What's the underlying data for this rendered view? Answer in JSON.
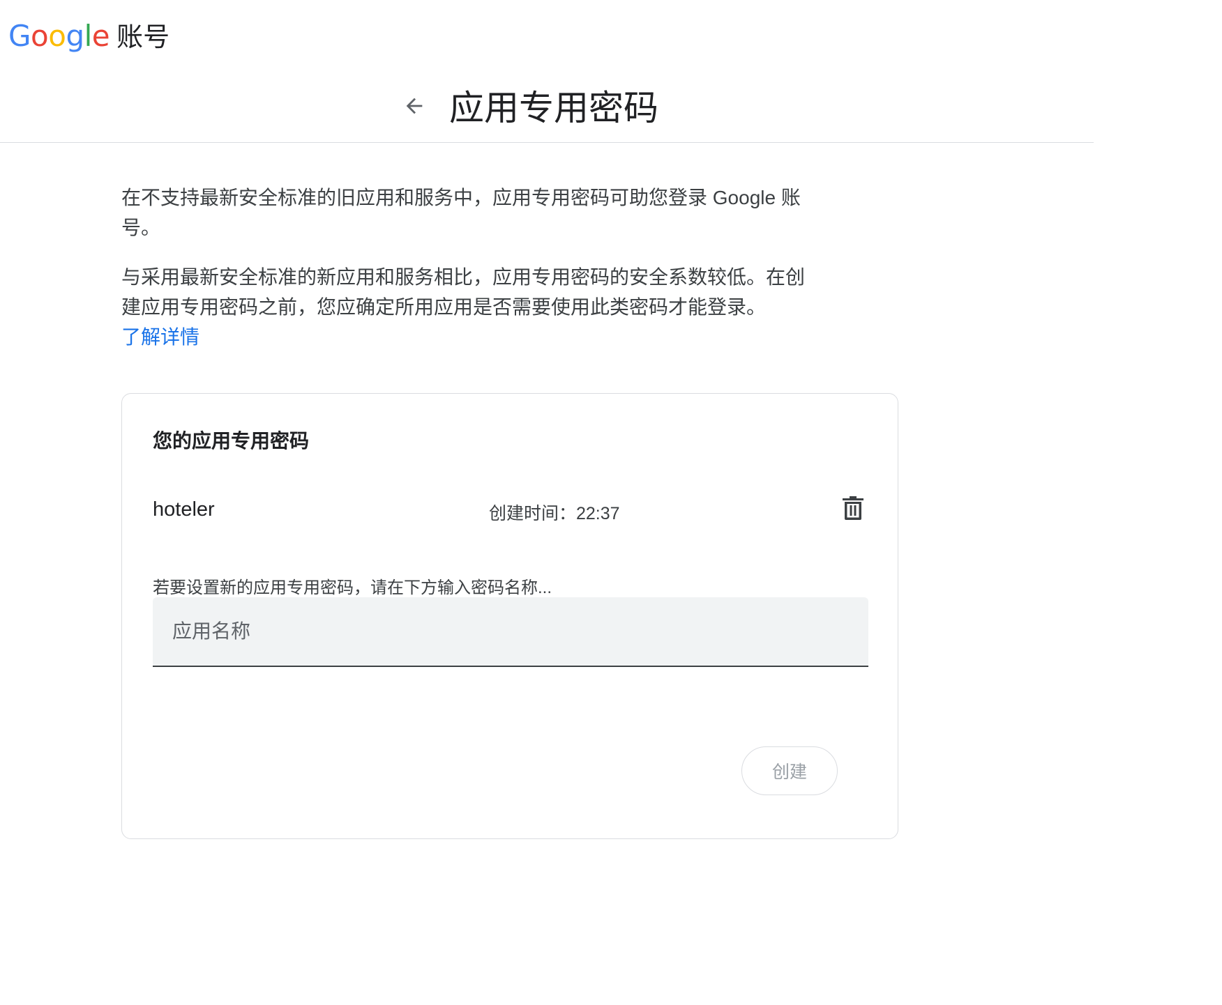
{
  "header": {
    "logo_letters": [
      "G",
      "o",
      "o",
      "g",
      "l",
      "e"
    ],
    "product_name": "账号"
  },
  "colors": {
    "google_blue": "#4285F4",
    "google_red": "#EA4335",
    "google_yellow": "#FBBC05",
    "google_green": "#34A853",
    "link": "#1a73e8"
  },
  "titlebar": {
    "back_icon": "arrow-left-icon",
    "title": "应用专用密码"
  },
  "intro": {
    "paragraph1": "在不支持最新安全标准的旧应用和服务中，应用专用密码可助您登录 Google 账号。",
    "paragraph2": "与采用最新安全标准的新应用和服务相比，应用专用密码的安全系数较低。在创建应用专用密码之前，您应确定所用应用是否需要使用此类密码才能登录。",
    "learn_more": "了解详情"
  },
  "card": {
    "title": "您的应用专用密码",
    "passwords": [
      {
        "name": "hoteler",
        "created": "创建时间：22:37",
        "delete_icon": "trash-icon"
      }
    ],
    "new_password_hint": "若要设置新的应用专用密码，请在下方输入密码名称...",
    "input_placeholder": "应用名称",
    "input_value": "",
    "create_label": "创建"
  }
}
